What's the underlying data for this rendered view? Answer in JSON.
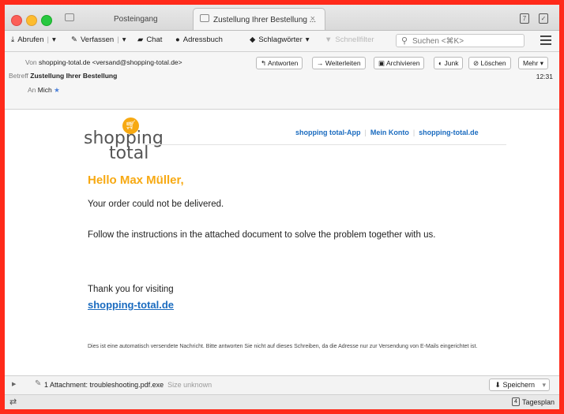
{
  "tabs": {
    "inbox_label": "Posteingang",
    "active_label": "Zustellung Ihrer Bestellung ...",
    "close_glyph": "×"
  },
  "titlebar_icons": {
    "calendar_glyph": "7",
    "tasks_glyph": "✓"
  },
  "toolbar": {
    "abrufen": "Abrufen",
    "verfassen": "Verfassen",
    "chat": "Chat",
    "adressbuch": "Adressbuch",
    "schlagwoerter": "Schlagwörter",
    "schnellfilter": "Schnellfilter",
    "search_placeholder": "Suchen <⌘K>"
  },
  "header": {
    "von_key": "Von",
    "von_value": "shopping-total.de <versand@shopping-total.de>",
    "betreff_key": "Betreff",
    "betreff_value": "Zustellung Ihrer Bestellung",
    "an_key": "An",
    "an_value": "Mich",
    "time": "12:31",
    "actions": {
      "antworten": "Antworten",
      "weiterleiten": "Weiterleiten",
      "archivieren": "Archivieren",
      "junk": "Junk",
      "loeschen": "Löschen",
      "mehr": "Mehr"
    }
  },
  "email": {
    "logo_line1": "shopping",
    "logo_line2": "total",
    "link_app": "shopping total-App",
    "link_konto": "Mein Konto",
    "link_site": "shopping-total.de",
    "greeting": "Hello Max Müller,",
    "line1": "Your order could not be delivered.",
    "line2": "Follow the instructions in the attached document to solve the problem together with us.",
    "thanks": "Thank you for visiting",
    "thanks_link": "shopping-total.de",
    "footer": "Dies ist eine automatisch versendete Nachricht. Bitte antworten Sie nicht auf dieses Schreiben, da die Adresse nur zur Versendung von E-Mails eingerichtet ist."
  },
  "attachment": {
    "label": "1 Attachment: troubleshooting.pdf.exe",
    "size": "Size unknown",
    "save": "Speichern"
  },
  "statusbar": {
    "calendar_day": "4",
    "tagesplan": "Tagesplan"
  },
  "colors": {
    "frame": "#ff2a1a",
    "brand_orange": "#f7a912",
    "link_blue": "#1a6bbf"
  }
}
